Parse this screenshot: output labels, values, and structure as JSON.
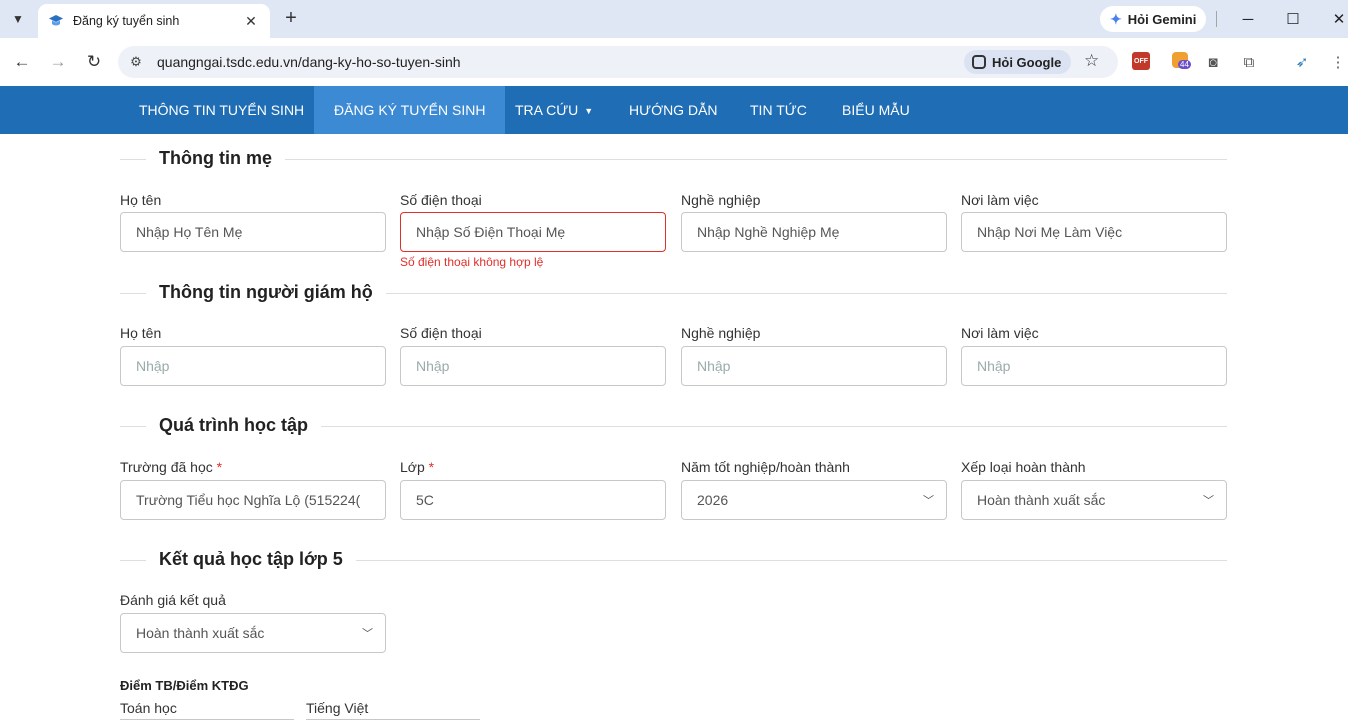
{
  "browser": {
    "tab_title": "Đăng ký tuyển sinh",
    "url": "quangngai.tsdc.edu.vn/dang-ky-ho-so-tuyen-sinh",
    "gemini_label": "Hỏi Gemini",
    "ask_google_label": "Hỏi Google",
    "ext_off_label": "OFF",
    "ext_badge_count": "44"
  },
  "nav": {
    "items": [
      "THÔNG TIN TUYỂN SINH",
      "ĐĂNG KÝ TUYỂN SINH",
      "TRA CỨU",
      "HƯỚNG DẪN",
      "TIN TỨC",
      "BIỂU MẪU"
    ],
    "active": "ĐĂNG KÝ TUYỂN SINH"
  },
  "mother": {
    "title": "Thông tin mẹ",
    "name_label": "Họ tên",
    "name_value": "Nhập Họ Tên Mẹ",
    "phone_label": "Số điện thoại",
    "phone_value": "Nhập Số Điện Thoại Mẹ",
    "phone_error": "Số điện thoại không hợp lệ",
    "job_label": "Nghề nghiệp",
    "job_value": "Nhập Nghề Nghiệp Mẹ",
    "work_label": "Nơi làm việc",
    "work_value": "Nhập Nơi Mẹ Làm Việc"
  },
  "guardian": {
    "title": "Thông tin người giám hộ",
    "name_label": "Họ tên",
    "phone_label": "Số điện thoại",
    "job_label": "Nghề nghiệp",
    "work_label": "Nơi làm việc",
    "placeholder": "Nhập"
  },
  "study": {
    "title": "Quá trình học tập",
    "school_label": "Trường đã học",
    "school_value": "Trường Tiểu học Nghĩa Lộ (515224(",
    "class_label": "Lớp",
    "class_value": "5C",
    "year_label": "Năm tốt nghiệp/hoàn thành",
    "year_value": "2026",
    "rank_label": "Xếp loại hoàn thành",
    "rank_value": "Hoàn thành xuất sắc",
    "required_mark": "*"
  },
  "results": {
    "title": "Kết quả học tập lớp 5",
    "eval_label": "Đánh giá kết quả",
    "eval_value": "Hoàn thành xuất sắc",
    "score_heading": "Điểm TB/Điểm KTĐG",
    "math_label": "Toán học",
    "viet_label": "Tiếng Việt"
  }
}
